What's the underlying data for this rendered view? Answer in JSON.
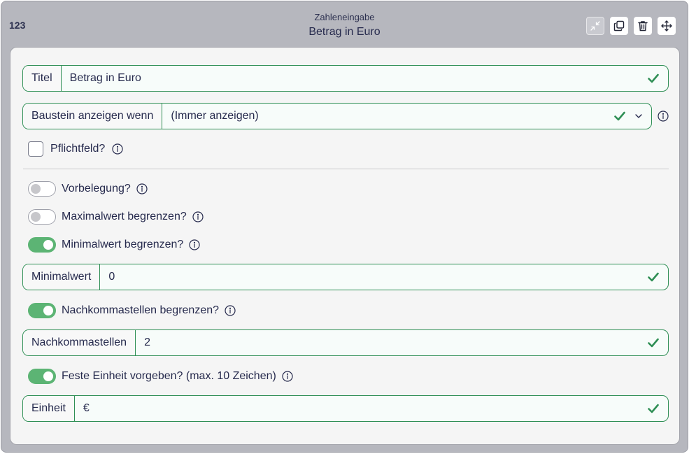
{
  "header": {
    "block_icon_label": "123",
    "subtitle": "Zahleneingabe",
    "title": "Betrag in Euro"
  },
  "toolbar": [
    {
      "icon": "collapse-icon",
      "disabled": true
    },
    {
      "icon": "copy-icon",
      "disabled": false
    },
    {
      "icon": "trash-icon",
      "disabled": false
    },
    {
      "icon": "move-icon",
      "disabled": false
    }
  ],
  "fields": {
    "titel": {
      "label": "Titel",
      "value": "Betrag in Euro"
    },
    "condition": {
      "label": "Baustein anzeigen wenn",
      "value": "(Immer anzeigen)"
    },
    "minimalwert": {
      "label": "Minimalwert",
      "value": "0"
    },
    "nachkommastellen": {
      "label": "Nachkommastellen",
      "value": "2"
    },
    "einheit": {
      "label": "Einheit",
      "value": "€"
    }
  },
  "options": {
    "pflichtfeld": {
      "label": "Pflichtfeld?",
      "checked": false
    },
    "vorbelegung": {
      "label": "Vorbelegung?",
      "on": false
    },
    "maximalwert": {
      "label": "Maximalwert begrenzen?",
      "on": false
    },
    "minimalwert": {
      "label": "Minimalwert begrenzen?",
      "on": true
    },
    "nachkommastellen": {
      "label": "Nachkommastellen begrenzen?",
      "on": true
    },
    "einheit": {
      "label": "Feste Einheit vorgeben? (max. 10 Zeichen)",
      "on": true
    }
  },
  "colors": {
    "accent_green": "#2f8f55",
    "toggle_on": "#5cb474",
    "panel_bg": "#b6b7be",
    "card_bg": "#f5f5f5"
  }
}
